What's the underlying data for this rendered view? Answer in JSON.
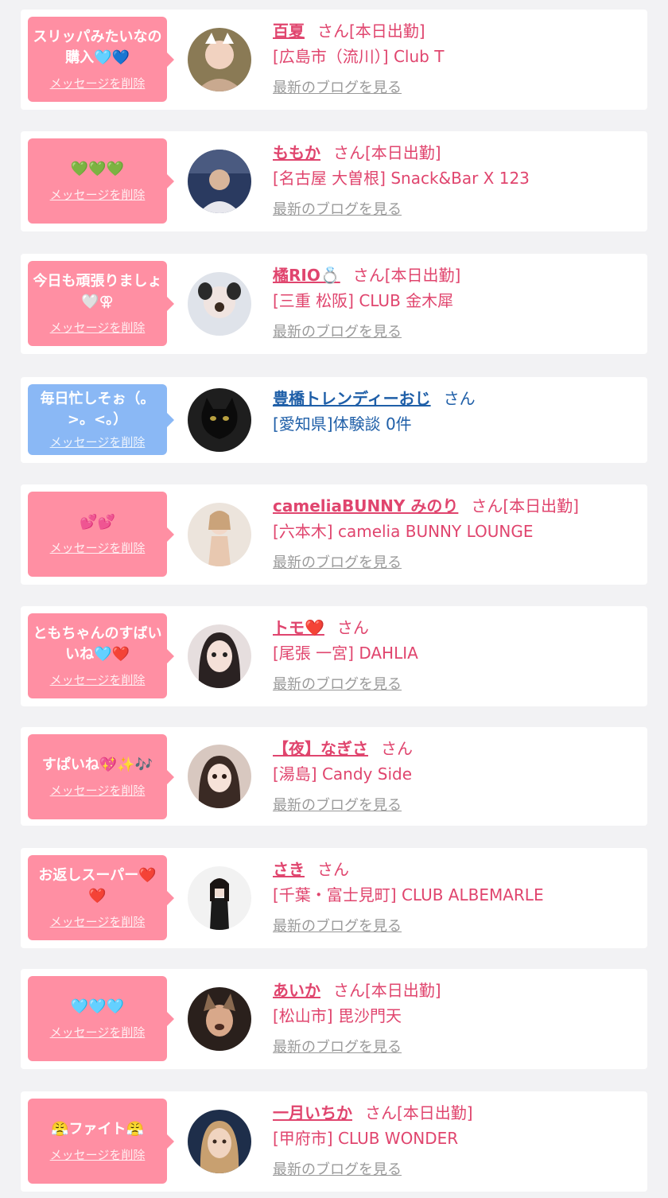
{
  "items": [
    {
      "message": "スリッパみたいなの購入🩵💙",
      "delete_label": "メッセージを削除",
      "name": "百夏",
      "san": "さん",
      "badge": "[本日出勤]",
      "shop": "[広島市（流川）] Club T",
      "blog": "最新のブログを見る",
      "avatar": "avatar-photo"
    },
    {
      "message": "💚💚💚",
      "delete_label": "メッセージを削除",
      "name": "ももか",
      "san": "さん",
      "badge": "[本日出勤]",
      "shop": "[名古屋 大曽根] Snack&Bar X 123",
      "blog": "最新のブログを見る",
      "avatar": "avatar-photo"
    },
    {
      "message": "今日も頑張りましょ🤍⚢",
      "delete_label": "メッセージを削除",
      "name": "橘RIO💍",
      "san": "さん",
      "badge": "[本日出勤]",
      "shop": "[三重 松阪] CLUB 金木犀",
      "blog": "最新のブログを見る",
      "avatar": "avatar-photo"
    },
    {
      "message": "毎日忙しそぉ（。>。<。）",
      "delete_label": "メッセージを削除",
      "name": "豊橋トレンディーおじ",
      "san": "さん",
      "badge": "",
      "shop": "[愛知県]体験談 0件",
      "blog": "",
      "avatar": "avatar-cat"
    },
    {
      "message": "💕💕",
      "delete_label": "メッセージを削除",
      "name": "cameliaBUNNY みのり",
      "san": "さん",
      "badge": "[本日出勤]",
      "shop": "[六本木] camelia BUNNY LOUNGE",
      "blog": "最新のブログを見る",
      "avatar": "avatar-photo"
    },
    {
      "message": "ともちゃんのすばいいね🩵❤️",
      "delete_label": "メッセージを削除",
      "name": "トモ❤️",
      "san": "さん",
      "badge": "",
      "shop": "[尾張 一宮] DAHLIA",
      "blog": "最新のブログを見る",
      "avatar": "avatar-photo"
    },
    {
      "message": "すぱいね💖✨🎶",
      "delete_label": "メッセージを削除",
      "name": "【夜】なぎさ",
      "san": "さん",
      "badge": "",
      "shop": "[湯島] Candy Side",
      "blog": "最新のブログを見る",
      "avatar": "avatar-photo"
    },
    {
      "message": "お返しスーパー❤️❤️",
      "delete_label": "メッセージを削除",
      "name": "さき",
      "san": "さん",
      "badge": "",
      "shop": "[千葉・富士見町] CLUB ALBEMARLE",
      "blog": "最新のブログを見る",
      "avatar": "avatar-photo"
    },
    {
      "message": "🩵🩵🩵",
      "delete_label": "メッセージを削除",
      "name": "あいか",
      "san": "さん",
      "badge": "[本日出勤]",
      "shop": "[松山市] 毘沙門天",
      "blog": "最新のブログを見る",
      "avatar": "avatar-photo"
    },
    {
      "message": "😤ファイト😤",
      "delete_label": "メッセージを削除",
      "name": "一月いちか",
      "san": "さん",
      "badge": "[本日出勤]",
      "shop": "[甲府市] CLUB WONDER",
      "blog": "最新のブログを見る",
      "avatar": "avatar-photo"
    }
  ]
}
